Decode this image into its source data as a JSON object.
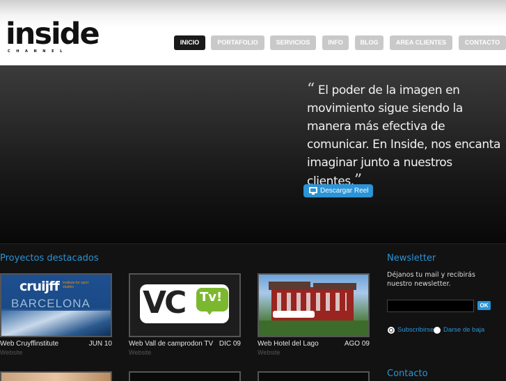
{
  "header": {
    "logo_text": "inside",
    "logo_sub": "CHANNEL",
    "nav": [
      {
        "label": "INICIO",
        "active": true
      },
      {
        "label": "PORTAFOLIO",
        "active": false
      },
      {
        "label": "SERVICIOS",
        "active": false
      },
      {
        "label": "INFO",
        "active": false
      },
      {
        "label": "BLOG",
        "active": false
      },
      {
        "label": "AREA CLIENTES",
        "active": false
      },
      {
        "label": "CONTACTO",
        "active": false
      }
    ]
  },
  "hero": {
    "quote_open": "“",
    "quote_text": "El poder de la imagen en movimiento sigue siendo la manera más efectiva de comunicar. En Inside, nos encanta imaginar junto a nuestros clientes.",
    "quote_close": "”",
    "reel_button": "Descargar Reel",
    "reel_icon": "monitor-icon"
  },
  "projects": {
    "title": "Proyectos destacados",
    "items": [
      {
        "title": "Web Cruyffinstitute",
        "date": "JUN 10",
        "category": "Website",
        "thumb_text": "cruijff",
        "thumb_sub": "BARCELONA",
        "thumb_tag": "Institute for sport studies"
      },
      {
        "title": "Web Vall de camprodon TV",
        "date": "DIC 09",
        "category": "Website",
        "thumb_text": "VC",
        "thumb_badge": "Tv!"
      },
      {
        "title": "Web Hotel del Lago",
        "date": "AGO 09",
        "category": "Website"
      }
    ]
  },
  "newsletter": {
    "title": "Newsletter",
    "description": "Déjanos tu mail y recibirás nuestro newsletter.",
    "input_value": "",
    "ok_label": "OK",
    "subscribe_label": "Subscribirse",
    "unsubscribe_label": "Darse de baja"
  },
  "contact": {
    "title": "Contacto"
  },
  "colors": {
    "accent": "#2b93d6",
    "nav_inactive": "#c9c9c9",
    "nav_active": "#1a1a1a"
  }
}
